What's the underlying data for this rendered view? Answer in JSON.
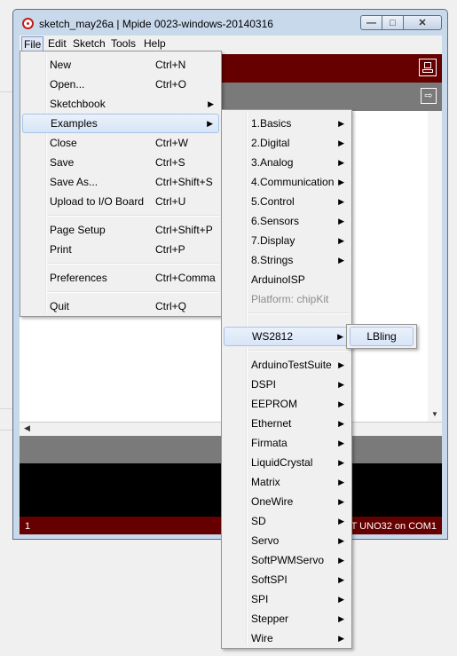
{
  "window": {
    "title": "sketch_may26a | Mpide 0023-windows-20140316",
    "minimize_glyph": "—",
    "maximize_glyph": "□",
    "close_glyph": "✕"
  },
  "menubar": [
    "File",
    "Edit",
    "Sketch",
    "Tools",
    "Help"
  ],
  "file_menu": {
    "new": {
      "label": "New",
      "shortcut": "Ctrl+N"
    },
    "open": {
      "label": "Open...",
      "shortcut": "Ctrl+O"
    },
    "sketchbook": {
      "label": "Sketchbook"
    },
    "examples": {
      "label": "Examples"
    },
    "close": {
      "label": "Close",
      "shortcut": "Ctrl+W"
    },
    "save": {
      "label": "Save",
      "shortcut": "Ctrl+S"
    },
    "save_as": {
      "label": "Save As...",
      "shortcut": "Ctrl+Shift+S"
    },
    "upload": {
      "label": "Upload to I/O Board",
      "shortcut": "Ctrl+U"
    },
    "page_setup": {
      "label": "Page Setup",
      "shortcut": "Ctrl+Shift+P"
    },
    "print": {
      "label": "Print",
      "shortcut": "Ctrl+P"
    },
    "preferences": {
      "label": "Preferences",
      "shortcut": "Ctrl+Comma"
    },
    "quit": {
      "label": "Quit",
      "shortcut": "Ctrl+Q"
    }
  },
  "examples_menu": {
    "basics": "1.Basics",
    "digital": "2.Digital",
    "analog": "3.Analog",
    "communication": "4.Communication",
    "control": "5.Control",
    "sensors": "6.Sensors",
    "display": "7.Display",
    "strings": "8.Strings",
    "arduinoisp": "ArduinoISP",
    "platform": "Platform: chipKit",
    "ws2812": "WS2812",
    "arduinotestsuite": "ArduinoTestSuite",
    "dspi": "DSPI",
    "eeprom": "EEPROM",
    "ethernet": "Ethernet",
    "firmata": "Firmata",
    "liquidcrystal": "LiquidCrystal",
    "matrix": "Matrix",
    "onewire": "OneWire",
    "sd": "SD",
    "servo": "Servo",
    "softpwmservo": "SoftPWMServo",
    "softspi": "SoftSPI",
    "spi": "SPI",
    "stepper": "Stepper",
    "wire": "Wire"
  },
  "ws2812_submenu": {
    "lbling": "LBling"
  },
  "status": {
    "line_number": "1",
    "board": "T UNO32 on COM1"
  },
  "glyphs": {
    "submenu_arrow": "▶",
    "scroll_up": "▲",
    "scroll_down": "▼",
    "scroll_left": "◀",
    "tab_arrow": "⇨"
  },
  "colors": {
    "toolbar": "#660000",
    "tabstrip": "#7a7a7a",
    "highlight": "#d7e5f7"
  }
}
